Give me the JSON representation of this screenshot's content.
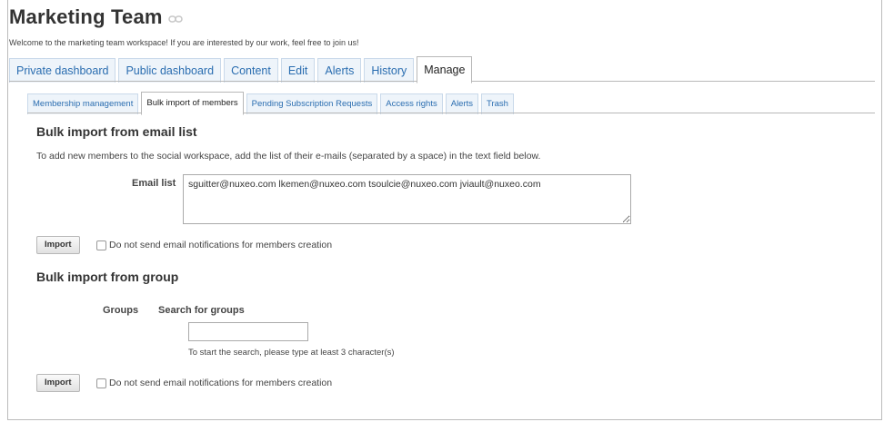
{
  "header": {
    "title": "Marketing Team",
    "welcome": "Welcome to the marketing team workspace! If you are interested by our work, feel free to join us!"
  },
  "tabs": [
    {
      "label": "Private dashboard"
    },
    {
      "label": "Public dashboard"
    },
    {
      "label": "Content"
    },
    {
      "label": "Edit"
    },
    {
      "label": "Alerts"
    },
    {
      "label": "History"
    },
    {
      "label": "Manage"
    }
  ],
  "active_tab": "Manage",
  "subtabs": [
    {
      "label": "Membership management"
    },
    {
      "label": "Bulk import of members"
    },
    {
      "label": "Pending Subscription Requests"
    },
    {
      "label": "Access rights"
    },
    {
      "label": "Alerts"
    },
    {
      "label": "Trash"
    }
  ],
  "active_subtab": "Bulk import of members",
  "email_section": {
    "heading": "Bulk import from email list",
    "description": "To add new members to the social workspace, add the list of their e-mails (separated by a space) in the text field below.",
    "field_label": "Email list",
    "field_value": "sguitter@nuxeo.com lkemen@nuxeo.com tsoulcie@nuxeo.com jviault@nuxeo.com",
    "import_label": "Import",
    "notify_label": "Do not send email notifications for members creation"
  },
  "group_section": {
    "heading": "Bulk import from group",
    "groups_label": "Groups",
    "search_label": "Search for groups",
    "search_value": "",
    "hint": "To start the search, please type at least 3 character(s)",
    "import_label": "Import",
    "notify_label": "Do not send email notifications for members creation"
  },
  "colors": {
    "tab_link": "#2a6db0",
    "tab_bg": "#eef4fa"
  }
}
